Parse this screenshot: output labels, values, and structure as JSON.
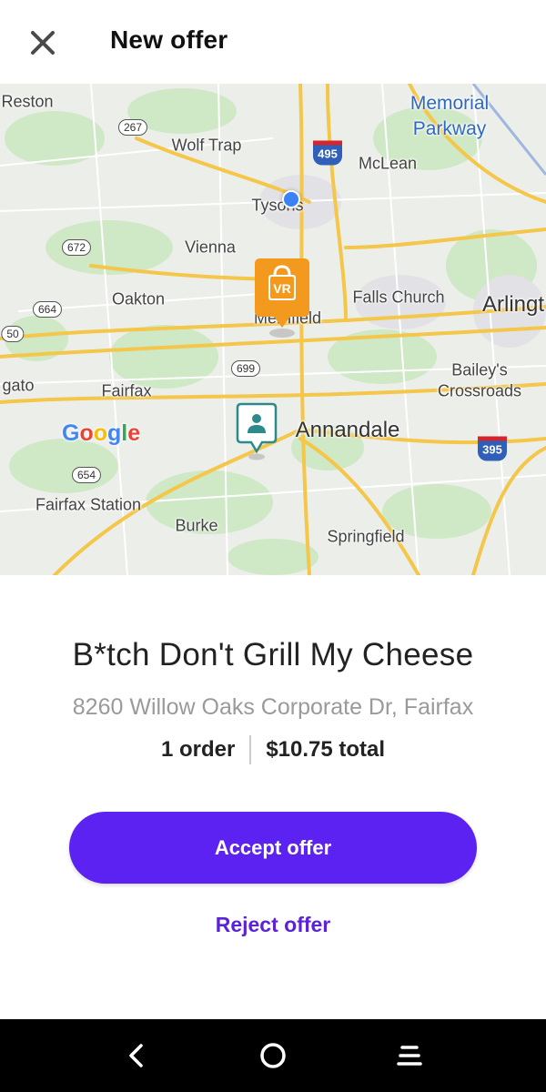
{
  "header": {
    "title": "New offer"
  },
  "map": {
    "labels": {
      "reston": "Reston",
      "memorial_parkway": "Memorial",
      "memorial_parkway2": "Parkway",
      "wolf_trap": "Wolf Trap",
      "mclean": "McLean",
      "tysons": "Tysons",
      "vienna": "Vienna",
      "oakton": "Oakton",
      "falls_church": "Falls Church",
      "arlington": "Arlingt",
      "merrifield": "Merrifield",
      "gato": "gato",
      "fairfax": "Fairfax",
      "baileys": "Bailey's",
      "baileys2": "Crossroads",
      "annandale": "Annandale",
      "fairfax_station": "Fairfax Station",
      "burke": "Burke",
      "springfield": "Springfield"
    },
    "shields": {
      "r267": "267",
      "r672": "672",
      "r664": "664",
      "r50": "50",
      "r699": "699",
      "r654": "654",
      "i495": "495",
      "i395": "395"
    },
    "google_logo": "Google",
    "store_pin_text": "VR"
  },
  "offer": {
    "restaurant_name": "B*tch Don't Grill My Cheese",
    "address": "8260 Willow Oaks Corporate Dr, Fairfax",
    "order_count": "1 order",
    "total": "$10.75 total"
  },
  "actions": {
    "accept_label": "Accept offer",
    "reject_label": "Reject offer"
  },
  "colors": {
    "accent": "#5b22f2",
    "store_pin": "#f39a1e",
    "customer_pin": "#2e8a8a"
  }
}
